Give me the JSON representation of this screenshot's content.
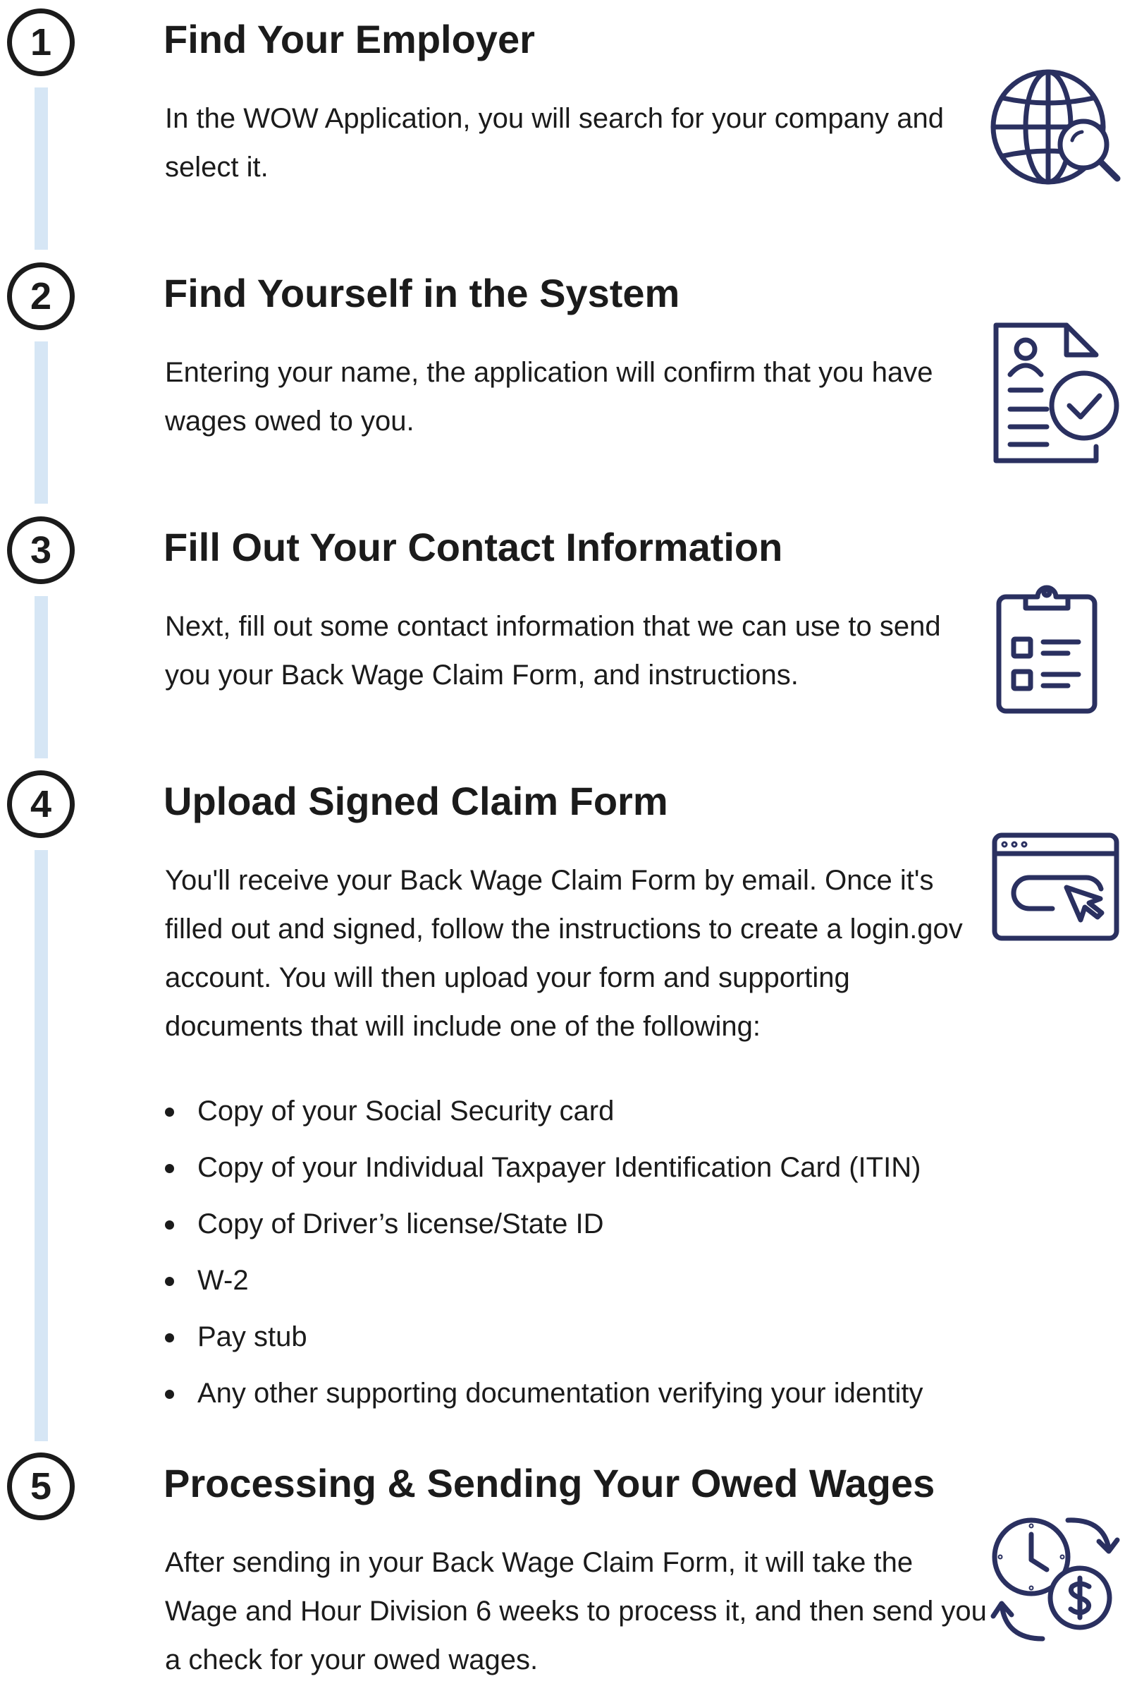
{
  "steps": [
    {
      "number": "1",
      "title": "Find Your Employer",
      "body": "In the WOW Application, you will search for your company and select it.",
      "icon": "globe-search-icon"
    },
    {
      "number": "2",
      "title": "Find Yourself in the System",
      "body": "Entering your name, the application will confirm that you have wages owed to you.",
      "icon": "document-check-icon"
    },
    {
      "number": "3",
      "title": "Fill Out Your Contact Information",
      "body": "Next, fill out some contact information that we can use to send you your Back Wage Claim Form, and instructions.",
      "icon": "clipboard-checklist-icon"
    },
    {
      "number": "4",
      "title": "Upload Signed Claim Form",
      "body": "You'll receive your Back Wage Claim Form by email.  Once it's filled out and signed, follow the instructions to create a login.gov account. You will then upload your form and supporting documents that will include one of the following:",
      "icon": "browser-click-icon",
      "documents": [
        "Copy of your Social Security card",
        "Copy of your Individual Taxpayer Identification Card (ITIN)",
        "Copy of Driver’s license/State ID",
        "W-2",
        "Pay stub",
        "Any other supporting documentation verifying your identity"
      ]
    },
    {
      "number": "5",
      "title": "Processing & Sending Your Owed Wages",
      "body": "After sending in your Back Wage Claim Form, it will take the Wage and Hour Division 6 weeks to process it, and then send you a check for your owed wages.",
      "icon": "clock-money-exchange-icon"
    }
  ],
  "colors": {
    "text": "#1b1b1b",
    "icon": "#2a3060",
    "timeline": "#d6e6f5"
  }
}
